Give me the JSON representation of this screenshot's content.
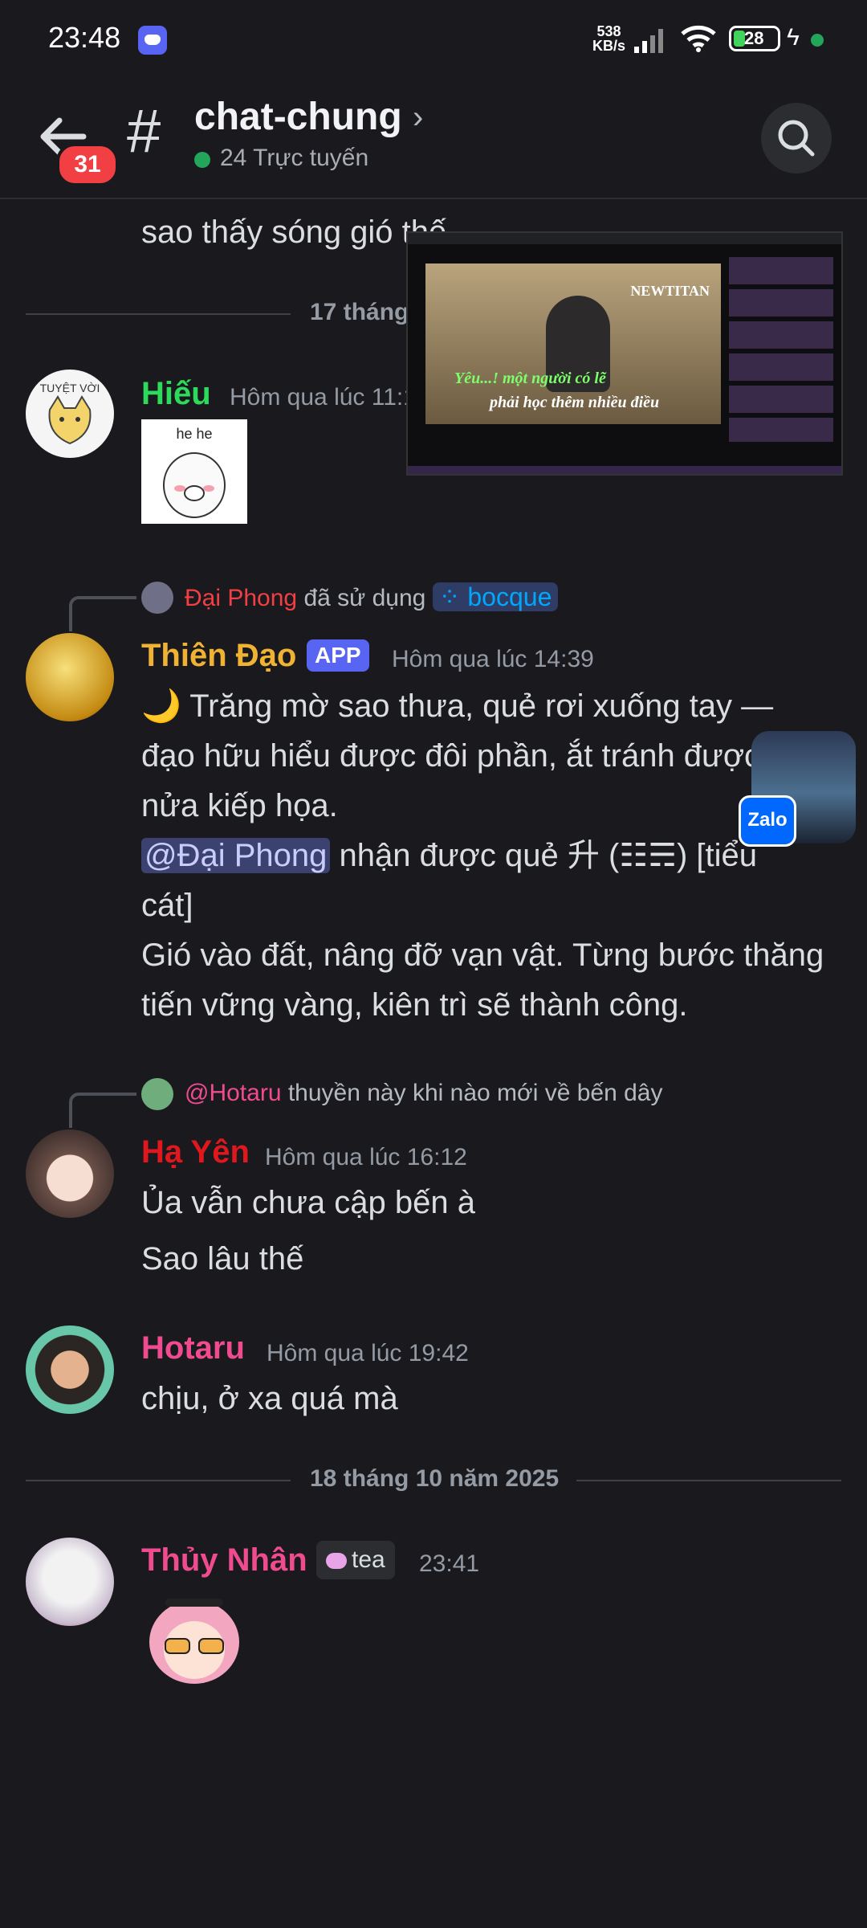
{
  "status_bar": {
    "time": "23:48",
    "net_speed_value": "538",
    "net_speed_unit": "KB/s",
    "battery": "28",
    "icons": [
      "discord-icon",
      "signal-icon",
      "wifi-icon",
      "battery-icon",
      "charging-icon"
    ]
  },
  "header": {
    "unread_count": "31",
    "channel": "chat-chung",
    "online": "24 Trực tuyến"
  },
  "messages": {
    "partial": "sao thấy sóng gió thế",
    "divider1": "17 tháng",
    "hieu": {
      "author": "Hiếu",
      "time": "Hôm qua lúc 11:1",
      "avatar_text": "TUYỆT VỜI",
      "sticker_text": "he he"
    },
    "thien_dao": {
      "reply_user": "Đại Phong",
      "reply_used": "đã sử dụng",
      "reply_command": "bocque",
      "author": "Thiên Đạo",
      "tag": "APP",
      "time": "Hôm qua lúc 14:39",
      "line1": "🌙 Trăng mờ sao thưa, quẻ rơi xuống tay —",
      "line2": "đạo hữu hiểu được đôi phần, ắt tránh được",
      "line3": "nửa kiếp họa.",
      "mention": "@Đại Phong",
      "line4": " nhận được quẻ 升 (☷☴) [tiểu",
      "line5": "cát]",
      "line6": "Gió vào đất, nâng đỡ vạn vật. Từng bước thăng",
      "line7": "tiến vững vàng, kiên trì sẽ thành công."
    },
    "ha_yen": {
      "reply_mention": "@Hotaru",
      "reply_text": "thuyền này khi nào mới về bến dây",
      "author": "Hạ Yên",
      "time": "Hôm qua lúc 16:12",
      "line1": "Ủa vẫn chưa cập bến à",
      "line2": "Sao lâu thế"
    },
    "hotaru": {
      "author": "Hotaru",
      "time": "Hôm qua lúc 19:42",
      "line1": "chịu, ở xa quá mà"
    },
    "divider2": "18 tháng 10 năm 2025",
    "thuy_nhan": {
      "author": "Thủy Nhân",
      "role": "tea",
      "time": "23:41"
    }
  },
  "pip": {
    "watermark": "NEWTITAN",
    "lyric1": "Yêu...! một người có lẽ",
    "lyric2": "phải học thêm nhiều điều"
  },
  "zalo": {
    "label": "Zalo"
  }
}
